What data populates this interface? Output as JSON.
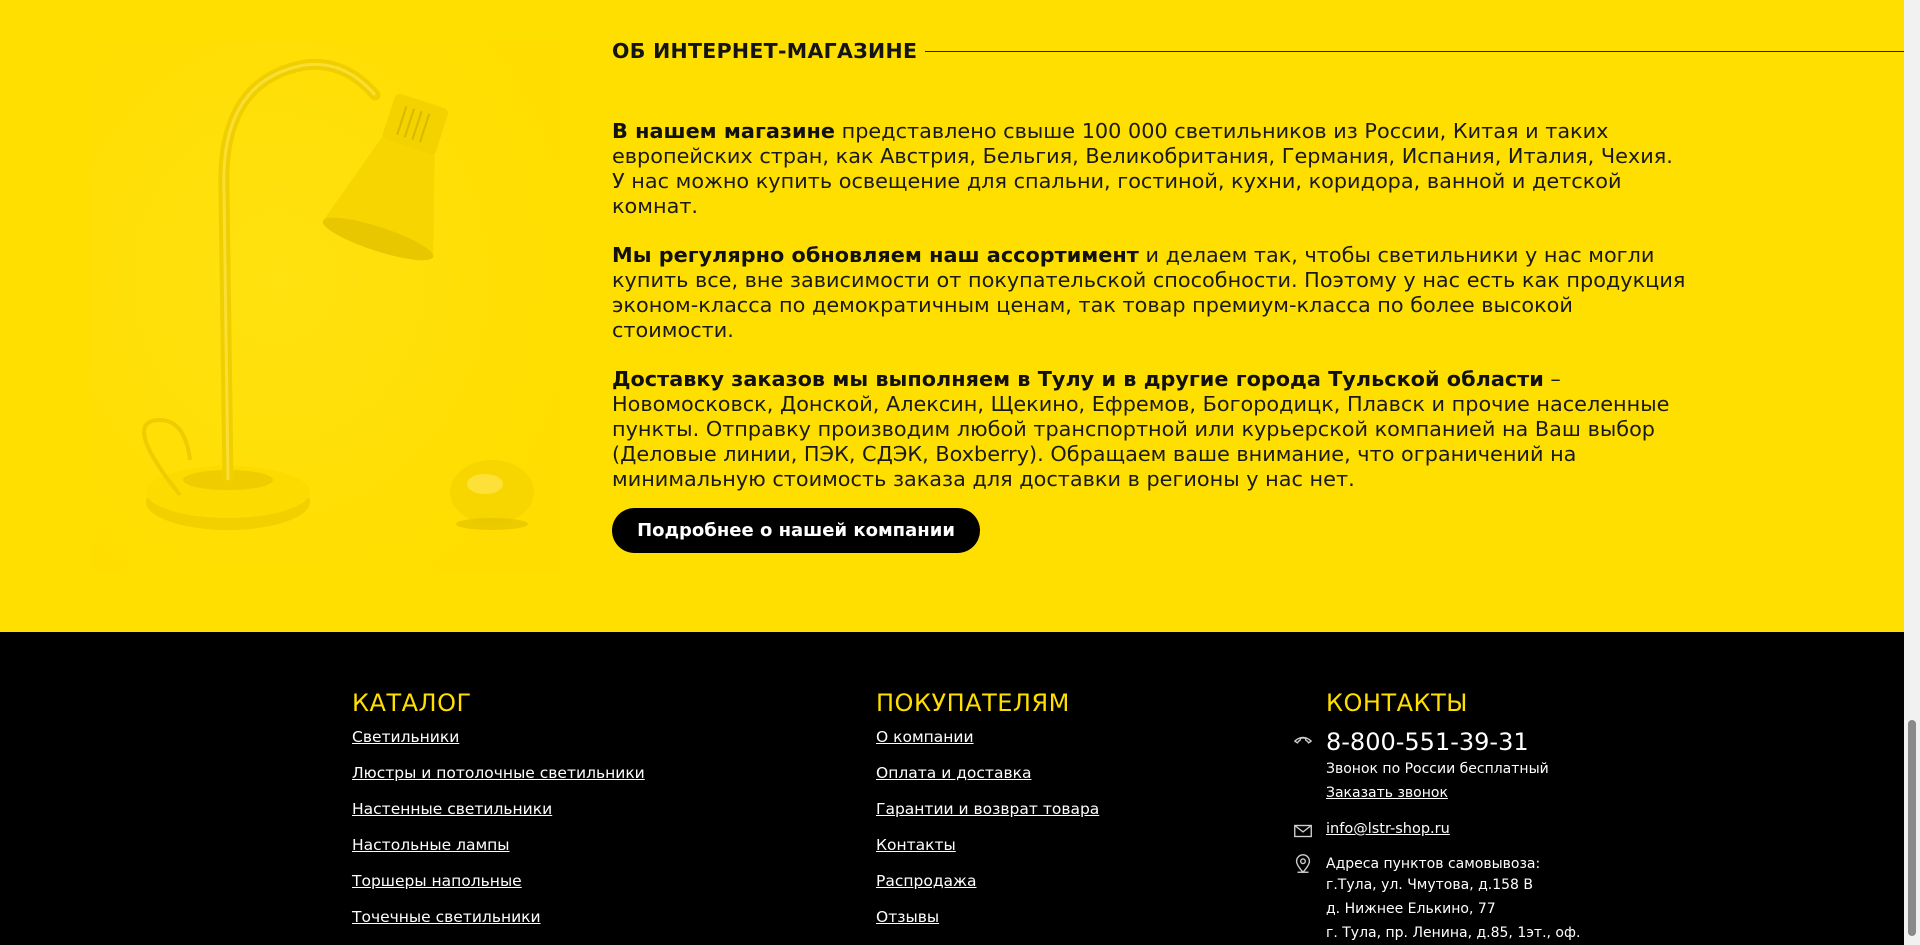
{
  "about": {
    "title": "ОБ ИНТЕРНЕТ-МАГАЗИНЕ",
    "p1_bold": "В нашем магазине",
    "p1_rest": " представлено свыше 100 000 светильников из России, Китая и таких европейских стран, как Австрия, Бельгия, Великобритания, Германия, Испания, Италия, Чехия. У нас можно купить освещение для спальни, гостиной, кухни, коридора, ванной и детской комнат.",
    "p2_bold": "Мы регулярно обновляем наш ассортимент",
    "p2_rest": " и делаем так, чтобы светильники у нас могли купить все, вне зависимости от покупательской способности. Поэтому у нас есть как продукция эконом-класса по демократичным ценам, так товар премиум-класса по более высокой стоимости.",
    "p3_bold": "Доставку заказов мы выполняем в Тулу и в другие города Тульской области",
    "p3_rest": " – Новомосковск, Донской, Алексин, Щекино, Ефремов, Богородицк, Плавск и прочие населенные пункты. Отправку производим любой транспортной или курьерской компанией на Ваш выбор (Деловые линии, ПЭК, СДЭК, Boxberry). Обращаем ваше внимание, что ограничений на минимальную стоимость заказа для доставки в регионы у нас нет.",
    "button_label": "Подробнее о нашей компании"
  },
  "footer": {
    "catalog": {
      "heading": "КАТАЛОГ",
      "links": [
        "Светильники",
        "Люстры и потолочные светильники",
        "Настенные светильники",
        "Настольные лампы",
        "Торшеры напольные",
        "Точечные светильники"
      ]
    },
    "buyers": {
      "heading": "ПОКУПАТЕЛЯМ",
      "links": [
        "О компании",
        "Оплата и доставка",
        "Гарантии и возврат товара",
        "Контакты",
        "Распродажа",
        "Отзывы"
      ]
    },
    "contacts": {
      "heading": "КОНТАКТЫ",
      "phone": "8-800-551-39-31",
      "phone_note": "Звонок по России бесплатный",
      "callback": "Заказать звонок",
      "email": "info@lstr-shop.ru",
      "pickup_title": "Адреса пунктов самовывоза:",
      "addresses": [
        "г.Тула, ул. Чмутова, д.158 В",
        "д. Нижнее Елькино, 77",
        "г. Тула, пр. Ленина, д.85, 1эт., оф."
      ]
    }
  },
  "colors": {
    "accent_yellow": "#ffdf00",
    "footer_bg": "#000000",
    "text_dark": "#1a1a1a"
  },
  "icons": [
    "phone-icon",
    "mail-icon",
    "location-pin-icon",
    "desk-lamp-illustration",
    "lemon-illustration"
  ]
}
